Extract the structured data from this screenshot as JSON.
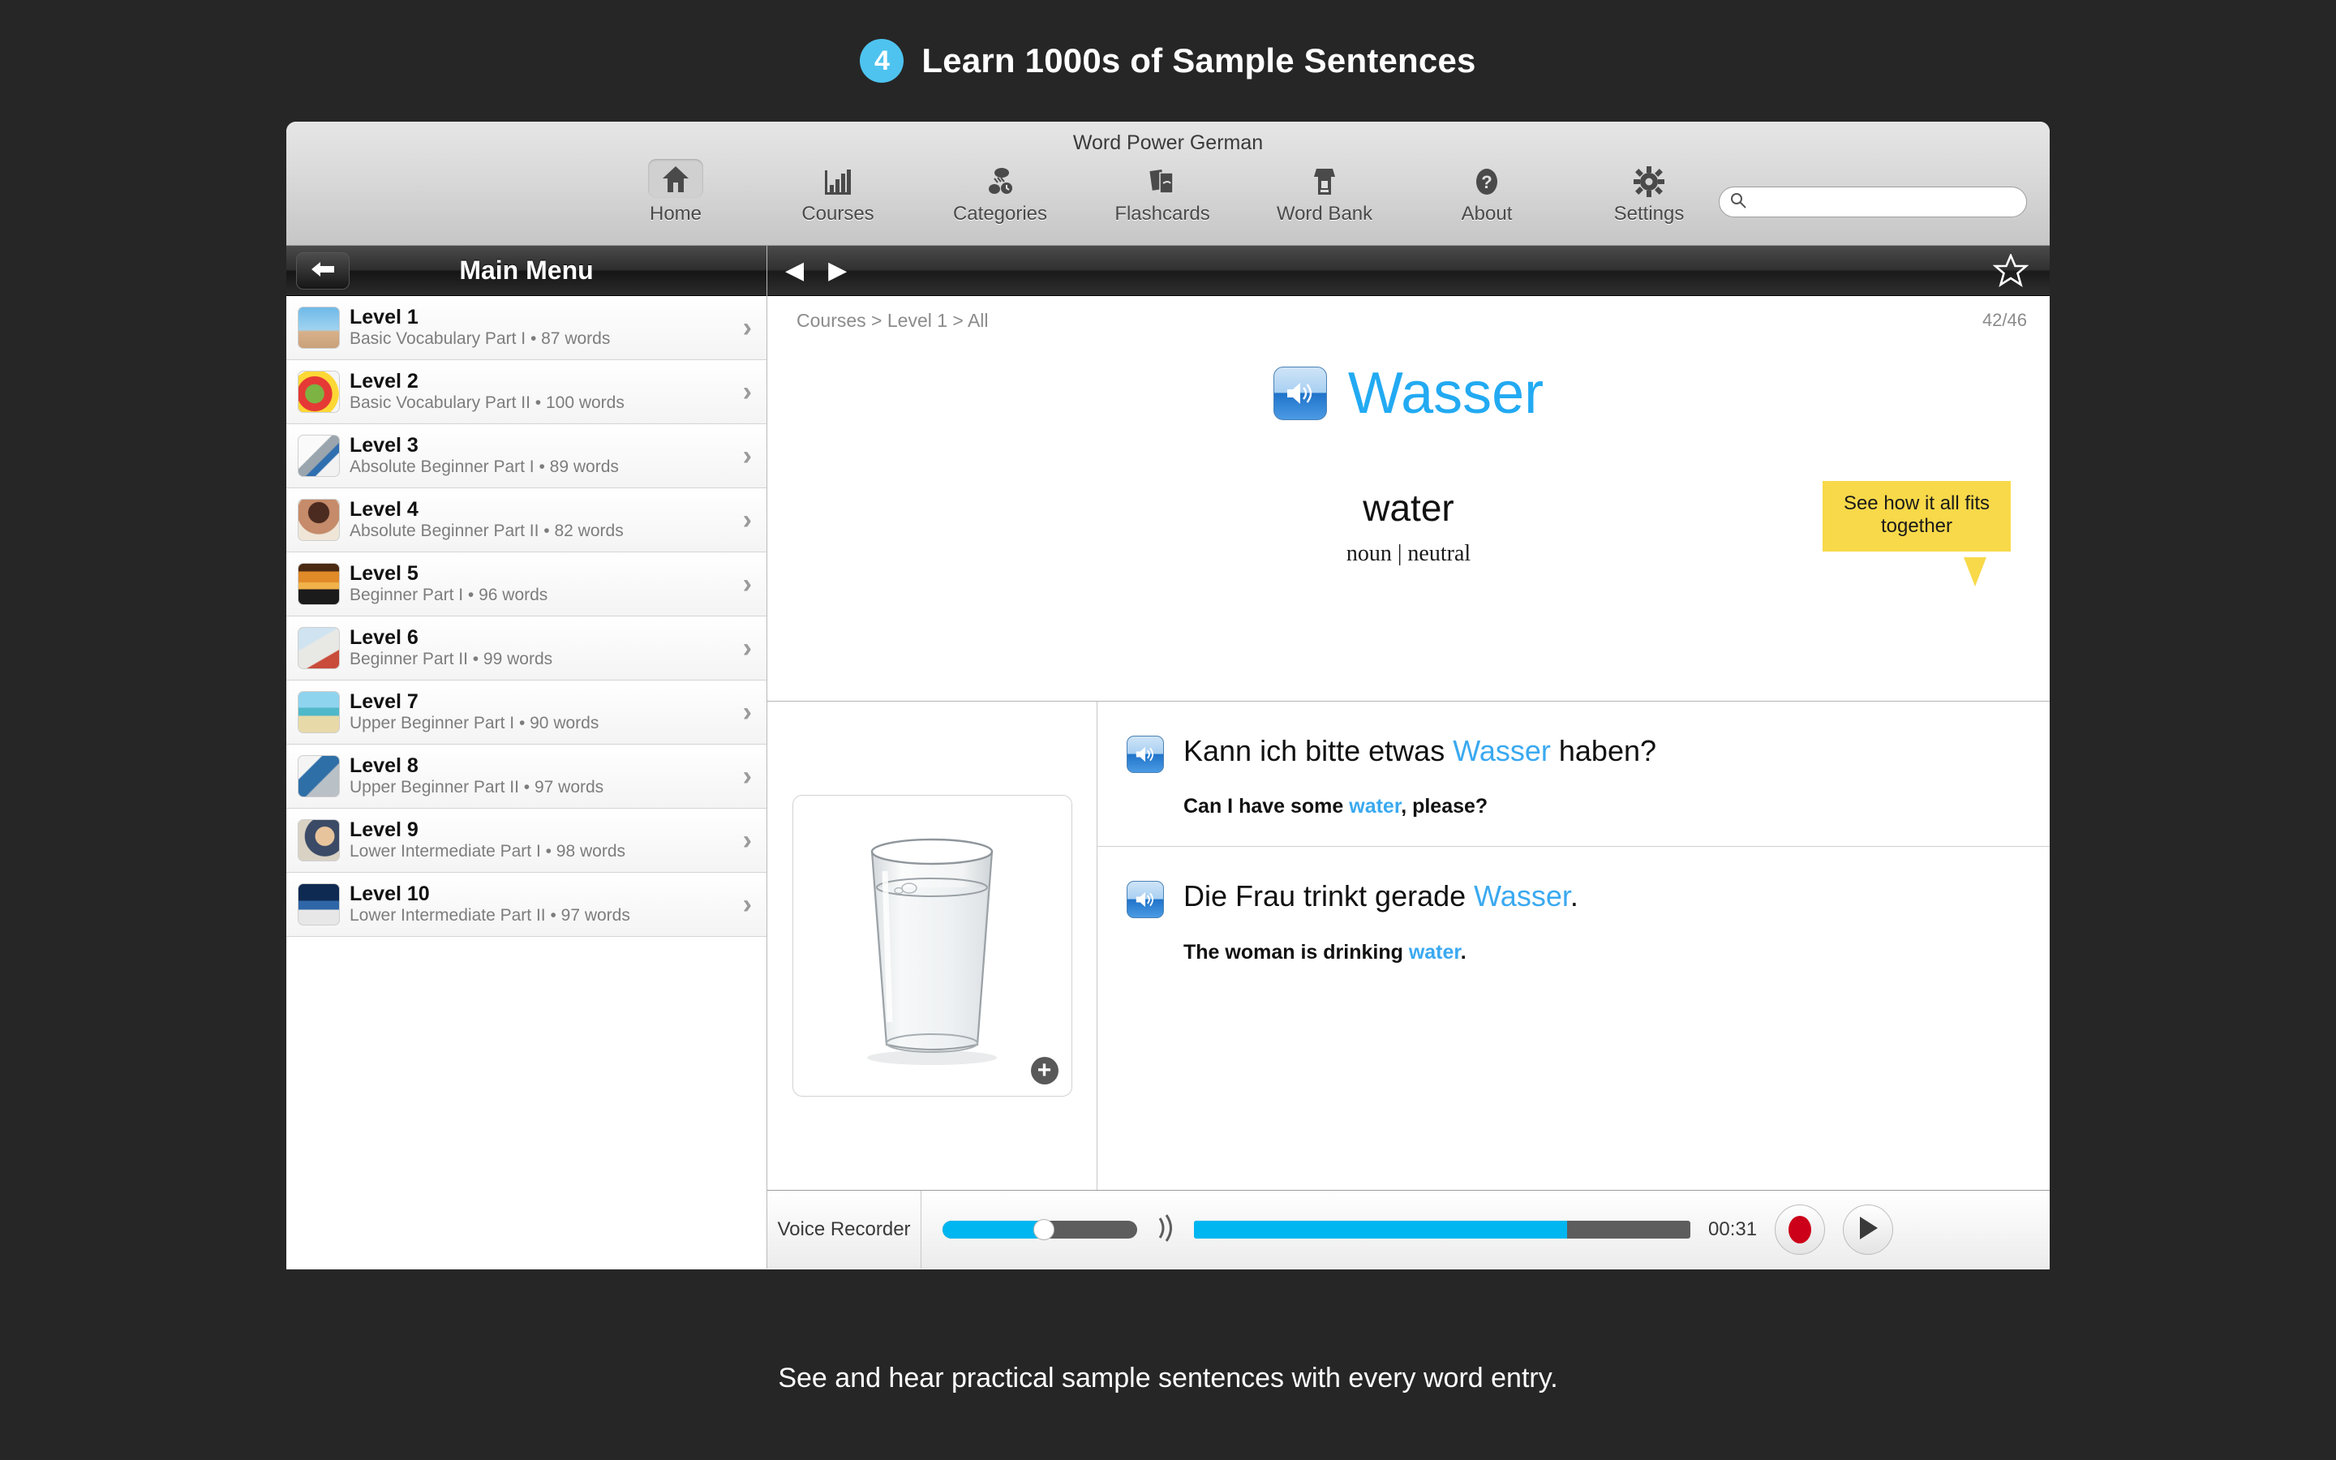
{
  "promo": {
    "badge_number": "4",
    "title": "Learn 1000s of Sample Sentences",
    "caption": "See and hear practical sample sentences with every word entry."
  },
  "window": {
    "title": "Word Power German"
  },
  "toolbar": {
    "items": [
      {
        "label": "Home",
        "icon": "home-icon",
        "active": true
      },
      {
        "label": "Courses",
        "icon": "bar-chart-icon",
        "active": false
      },
      {
        "label": "Categories",
        "icon": "categories-icon",
        "active": false
      },
      {
        "label": "Flashcards",
        "icon": "flashcards-icon",
        "active": false
      },
      {
        "label": "Word Bank",
        "icon": "word-bank-icon",
        "active": false
      },
      {
        "label": "About",
        "icon": "question-mark-icon",
        "active": false
      },
      {
        "label": "Settings",
        "icon": "gear-icon",
        "active": false
      }
    ],
    "search": {
      "value": "",
      "placeholder": ""
    }
  },
  "sidebar": {
    "title": "Main Menu",
    "back_label": "Back",
    "levels": [
      {
        "name": "Level 1",
        "sub": "Basic Vocabulary Part I • 87 words",
        "thumb": "hurdle-runner"
      },
      {
        "name": "Level 2",
        "sub": "Basic Vocabulary Part II • 100 words",
        "thumb": "vegetables"
      },
      {
        "name": "Level 3",
        "sub": "Absolute Beginner Part I • 89 words",
        "thumb": "keys"
      },
      {
        "name": "Level 4",
        "sub": "Absolute Beginner Part II • 82 words",
        "thumb": "woman-brushing-teeth"
      },
      {
        "name": "Level 5",
        "sub": "Beginner Part I • 96 words",
        "thumb": "sunset"
      },
      {
        "name": "Level 6",
        "sub": "Beginner Part II • 99 words",
        "thumb": "newspaper"
      },
      {
        "name": "Level 7",
        "sub": "Upper Beginner Part I • 90 words",
        "thumb": "beach-hammock"
      },
      {
        "name": "Level 8",
        "sub": "Upper Beginner Part II • 97 words",
        "thumb": "laptop"
      },
      {
        "name": "Level 9",
        "sub": "Lower Intermediate Part I • 98 words",
        "thumb": "classroom-teacher"
      },
      {
        "name": "Level 10",
        "sub": "Lower Intermediate Part II • 97 words",
        "thumb": "boxer"
      }
    ]
  },
  "main": {
    "breadcrumb": "Courses > Level 1 > All",
    "counter": "42/46",
    "word": {
      "target": "Wasser",
      "translation": "water",
      "part_of_speech": "noun | neutral"
    },
    "callout": "See how it all fits together",
    "image_caption": "glass of water",
    "sentences": [
      {
        "target_pre": "Kann ich bitte etwas ",
        "target_hl": "Wasser",
        "target_post": " haben?",
        "english_pre": "Can I have some ",
        "english_hl": "water",
        "english_post": ", please?"
      },
      {
        "target_pre": "Die Frau trinkt gerade ",
        "target_hl": "Wasser",
        "target_post": ".",
        "english_pre": "The woman is drinking ",
        "english_hl": "water",
        "english_post": "."
      }
    ]
  },
  "recorder": {
    "label": "Voice Recorder",
    "time": "00:31",
    "volume_percent": 50,
    "progress_percent": 75,
    "record_label": "Record",
    "play_label": "Play"
  },
  "colors": {
    "accent_blue": "#22aaf2",
    "link_blue": "#3aa9f0",
    "callout_yellow": "#f8d949",
    "badge_blue": "#4ec3ef",
    "record_red": "#cc0019",
    "progress_blue": "#00b6f0"
  }
}
